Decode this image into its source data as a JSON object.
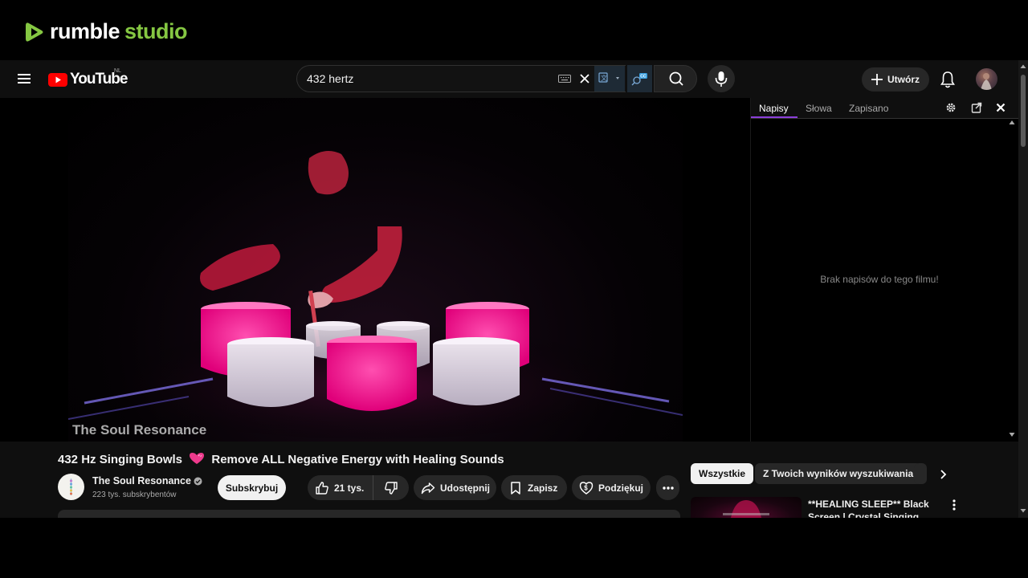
{
  "branding": {
    "word1": "rumble",
    "word2": "studio",
    "accent": "#85c742"
  },
  "header": {
    "logo_text": "YouTube",
    "region": "NL",
    "search_value": "432 hertz",
    "create_label": "Utwórz"
  },
  "video": {
    "watermark": "The Soul Resonance"
  },
  "captions_panel": {
    "tabs": [
      "Napisy",
      "Słowa",
      "Zapisano"
    ],
    "active_tab": "Napisy",
    "empty_message": "Brak napisów do tego filmu!",
    "accent": "#8b3fd9"
  },
  "watch": {
    "title_before": "432 Hz Singing Bowls",
    "title_after": "Remove ALL Negative Energy with Healing Sounds",
    "channel_name": "The Soul Resonance",
    "subscribers": "223 tys. subskrybentów",
    "subscribe_label": "Subskrybuj",
    "likes": "21 tys.",
    "share_label": "Udostępnij",
    "save_label": "Zapisz",
    "thanks_label": "Podziękuj"
  },
  "recommendations": {
    "chips": [
      "Wszystkie",
      "Z Twoich wyników wyszukiwania"
    ],
    "active_chip": "Wszystkie",
    "first_title": "**HEALING SLEEP** Black Screen | Crystal Singing Bowls"
  }
}
